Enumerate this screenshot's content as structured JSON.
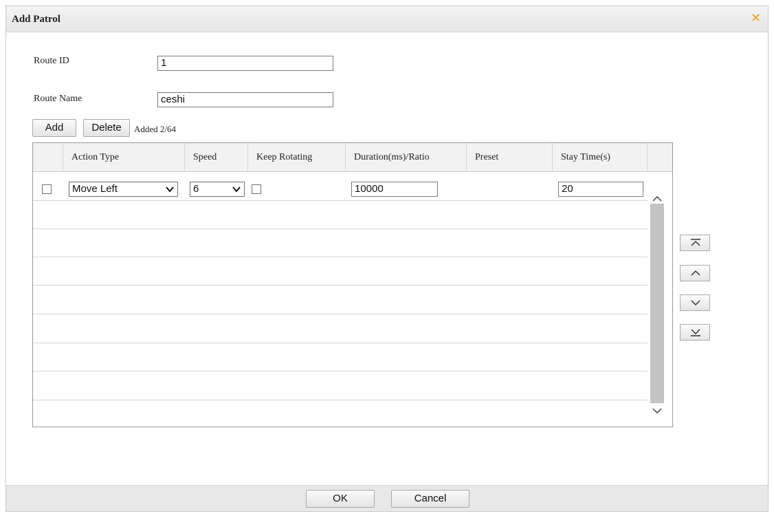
{
  "dialog": {
    "title": "Add Patrol",
    "close_icon": "close-icon"
  },
  "form": {
    "route_id_label": "Route ID",
    "route_id_value": "1",
    "route_name_label": "Route Name",
    "route_name_value": "ceshi"
  },
  "toolbar": {
    "add_label": "Add",
    "delete_label": "Delete",
    "count_text": "Added 2/64"
  },
  "table": {
    "headers": [
      "Action Type",
      "Speed",
      "Keep Rotating",
      "Duration(ms)/Ratio",
      "Preset",
      "Stay Time(s)"
    ],
    "rows": [
      {
        "action_type": "Move Left",
        "speed": "6",
        "keep_rotating": false,
        "duration": "10000",
        "preset": "",
        "stay_time": "20"
      }
    ]
  },
  "side_buttons": [
    "move-to-top-icon",
    "move-up-icon",
    "move-down-icon",
    "move-to-bottom-icon"
  ],
  "footer": {
    "ok_label": "OK",
    "cancel_label": "Cancel"
  },
  "colors": {
    "close_icon": "#f0a020",
    "header_bg": "#f2f2f2",
    "footer_bg": "#e8e8e8"
  }
}
